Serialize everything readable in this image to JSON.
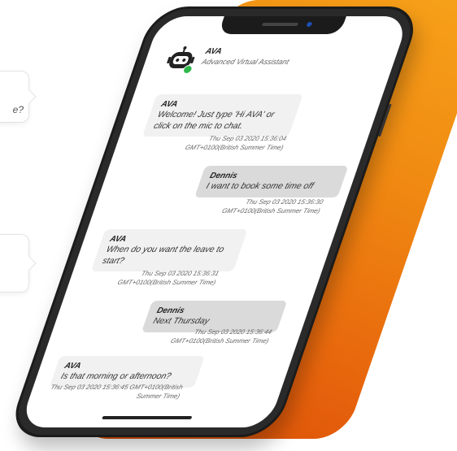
{
  "left_bubbles": {
    "first_fragment": "e?"
  },
  "header": {
    "name": "AVA",
    "subtitle": "Advanced Virtual Assistant"
  },
  "messages": [
    {
      "sender": "AVA",
      "text": "Welcome! Just type 'Hi AVA' or click on the mic to chat.",
      "timestamp": "Thu Sep 03 2020 15:36:04 GMT+0100(British Summer Time)"
    },
    {
      "sender": "Dennis",
      "text": "I want to book some time off",
      "timestamp": "Thu Sep 03 2020 15:36:30 GMT+0100(British Summer Time)"
    },
    {
      "sender": "AVA",
      "text": "When do you want the leave to start?",
      "timestamp": "Thu Sep 03 2020 15:36:31 GMT+0100(British Summer Time)"
    },
    {
      "sender": "Dennis",
      "text": "Next Thursday",
      "timestamp": "Thu Sep 03 2020 15:36:44 GMT+0100(British Summer Time)"
    },
    {
      "sender": "AVA",
      "text": "Is that morning or afternoon?",
      "timestamp": "Thu Sep 03 2020 15:36:45 GMT+0100(British Summer Time)"
    }
  ],
  "colors": {
    "accent_orange": "#f08a12",
    "online_green": "#2eb84a",
    "bot_bubble": "#f1f1f1",
    "user_bubble": "#dadada"
  }
}
